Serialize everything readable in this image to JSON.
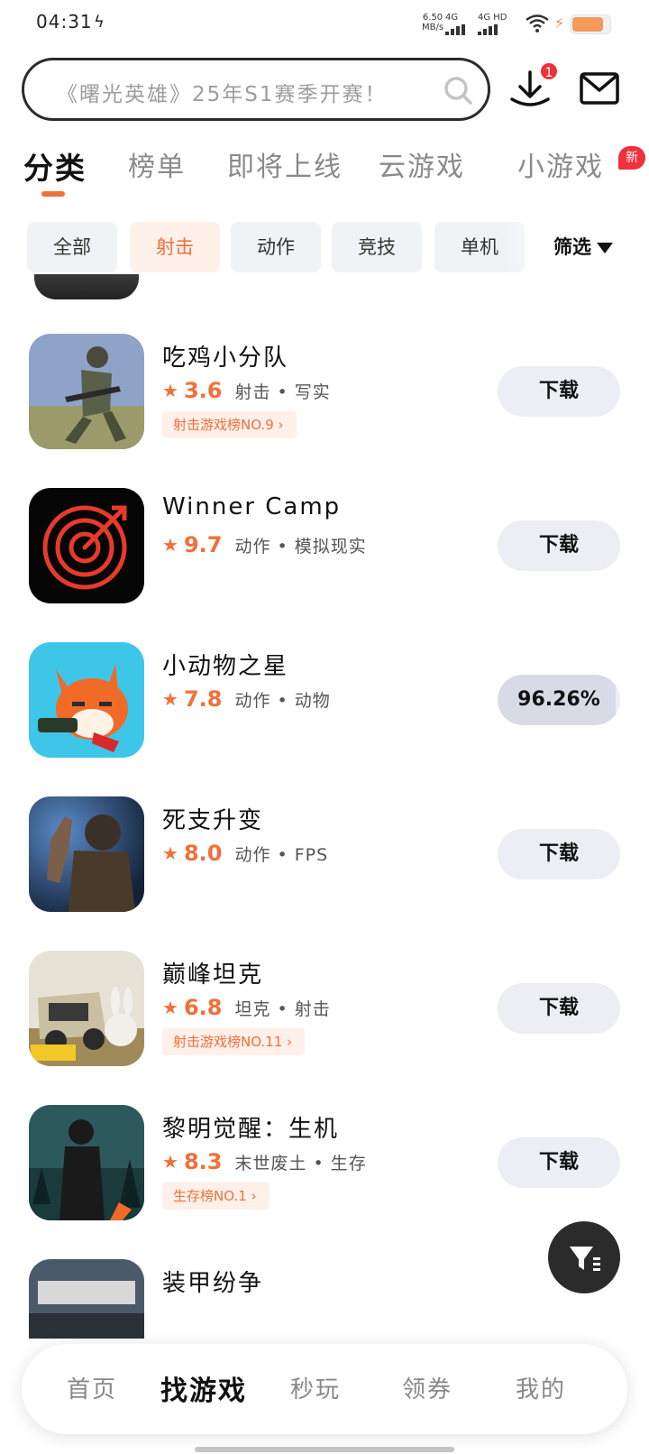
{
  "status_bar": {
    "time": "04:31",
    "net_speed_value": "6.50",
    "net_speed_unit": "MB/s",
    "sim1_label": "4G",
    "sim2_label": "4G HD"
  },
  "header": {
    "search_placeholder": "《曙光英雄》25年S1赛季开赛！",
    "download_badge": "1"
  },
  "tabs": [
    "分类",
    "榜单",
    "即将上线",
    "云游戏",
    "小游戏"
  ],
  "new_badge": "新",
  "chips": [
    "全部",
    "射击",
    "动作",
    "竞技",
    "单机"
  ],
  "filter_label": "筛选",
  "games": [
    {
      "name": "吃鸡小分队",
      "score": "3.6",
      "tags": "射击 • 写实",
      "rank": "射击游戏榜NO.9 ›",
      "button": "下载"
    },
    {
      "name": "Winner Camp",
      "score": "9.7",
      "tags": "动作 • 模拟现实",
      "rank": "",
      "button": "下载"
    },
    {
      "name": "小动物之星",
      "score": "7.8",
      "tags": "动作 • 动物",
      "rank": "",
      "button": "96.26%",
      "progress": 0.9626
    },
    {
      "name": "死支升变",
      "score": "8.0",
      "tags": "动作 • FPS",
      "rank": "",
      "button": "下载"
    },
    {
      "name": "巅峰坦克",
      "score": "6.8",
      "tags": "坦克 • 射击",
      "rank": "射击游戏榜NO.11 ›",
      "button": "下载"
    },
    {
      "name": "黎明觉醒：生机",
      "score": "8.3",
      "tags": "末世废土 • 生存",
      "rank": "生存榜NO.1 ›",
      "button": "下载"
    },
    {
      "name": "装甲纷争",
      "score": "",
      "tags": "",
      "rank": "",
      "button": ""
    }
  ],
  "bottom_nav": [
    "首页",
    "找游戏",
    "秒玩",
    "领券",
    "我的"
  ],
  "colors": {
    "accent": "#f0703a",
    "badge_red": "#f0303a",
    "chip_bg": "#f1f2f5",
    "button_bg": "#eceef3"
  }
}
